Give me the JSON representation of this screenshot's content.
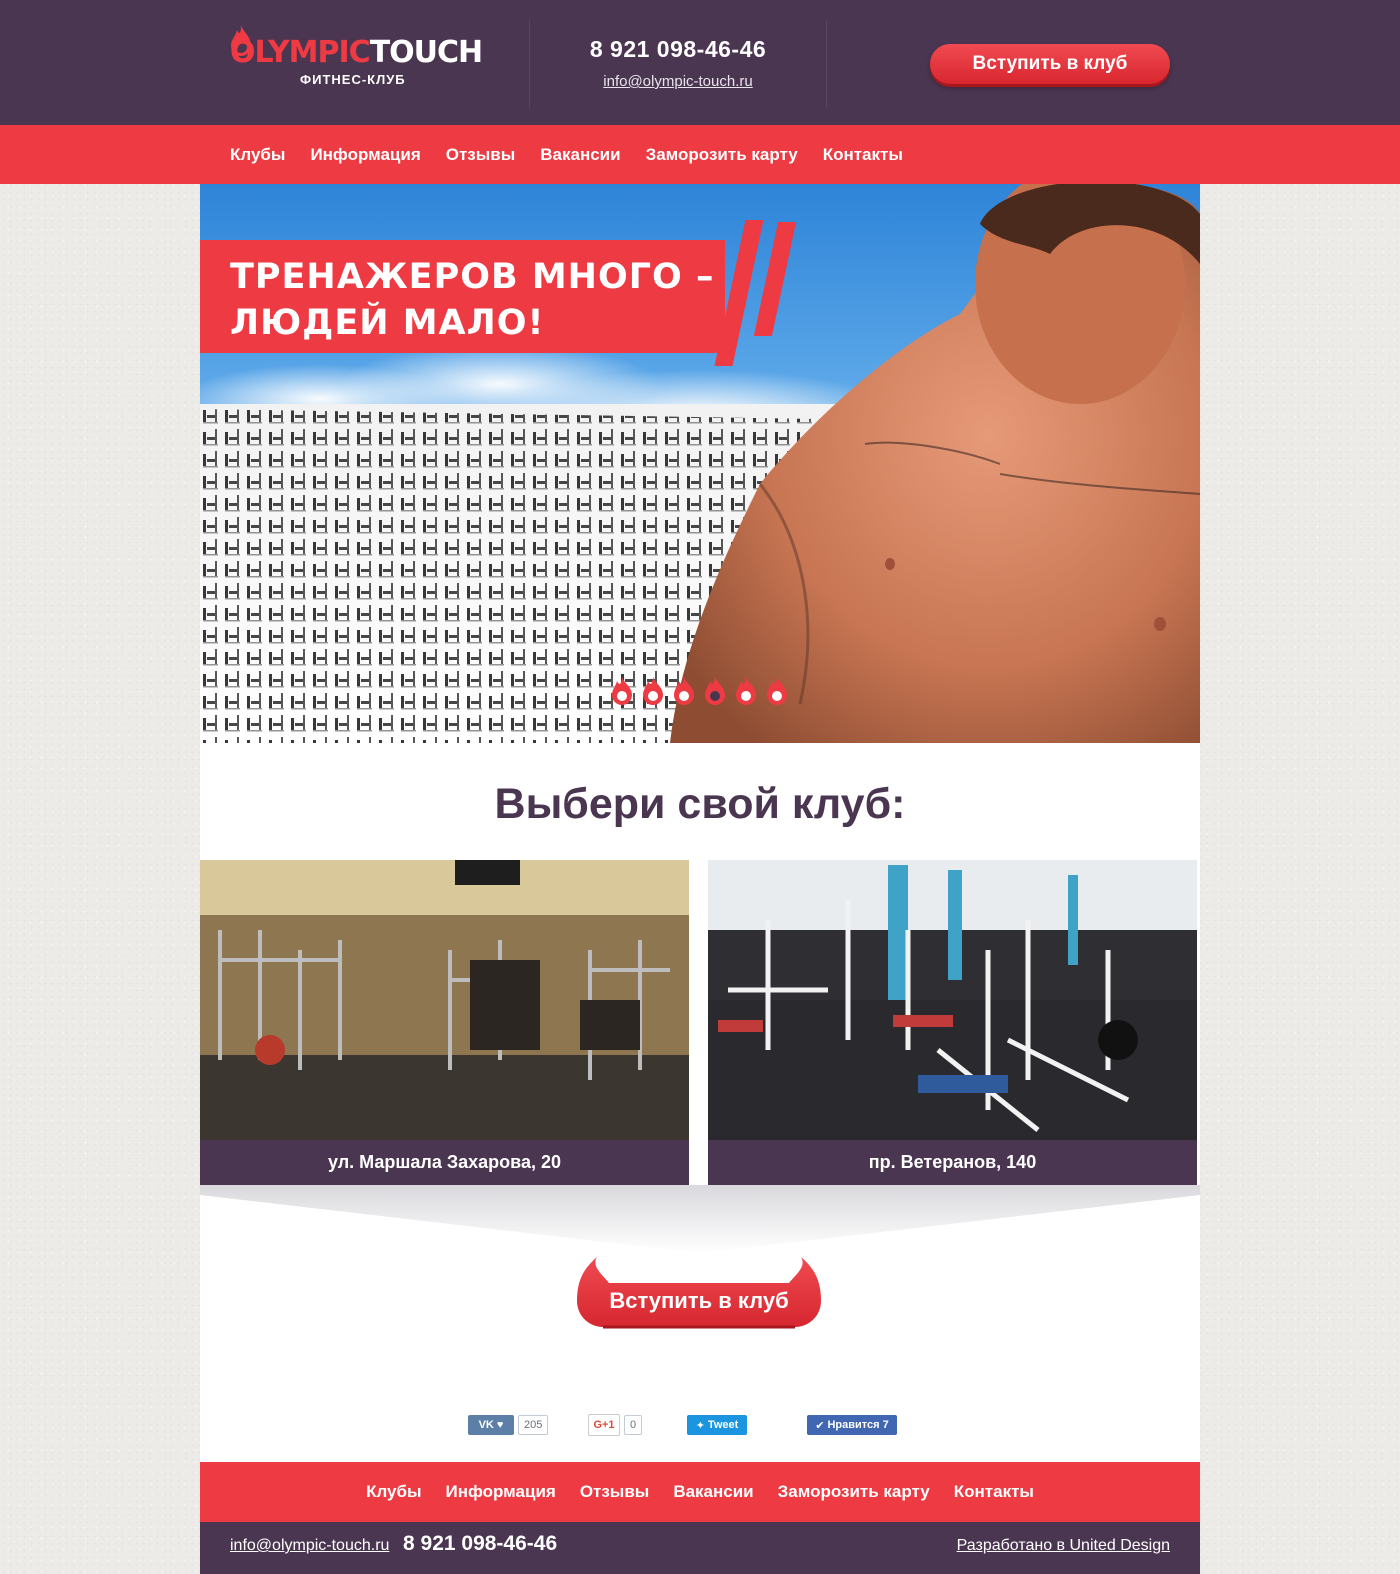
{
  "header": {
    "logo_part1": "OLYMPIC",
    "logo_part2": "TOUCH",
    "logo_subtitle": "ФИТНЕС-КЛУБ",
    "phone": "8 921 098-46-46",
    "email": "info@olympic-touch.ru",
    "join_button": "Вступить в клуб"
  },
  "nav": {
    "items": [
      "Клубы",
      "Информация",
      "Отзывы",
      "Вакансии",
      "Заморозить карту",
      "Контакты"
    ]
  },
  "hero": {
    "slogan_line1": "ТРЕНАЖЕРОВ МНОГО –",
    "slogan_line2": "ЛЮДЕЙ МАЛО!",
    "slides_count": 6,
    "active_slide": 4
  },
  "clubs": {
    "title": "Выбери свой клуб:",
    "items": [
      {
        "address": "ул. Маршала Захарова, 20"
      },
      {
        "address": "пр. Ветеранов, 140"
      }
    ],
    "join_button": "Вступить в клуб"
  },
  "social": {
    "vk_count": "205",
    "gplus_label": "G+1",
    "gplus_count": "0",
    "tweet_label": "Tweet",
    "fb_label": "Нравится 7"
  },
  "footer": {
    "nav_items": [
      "Клубы",
      "Информация",
      "Отзывы",
      "Вакансии",
      "Заморозить карту",
      "Контакты"
    ],
    "email": "info@olympic-touch.ru",
    "phone": "8 921 098-46-46",
    "developer": "Разработано в United Design"
  },
  "colors": {
    "purple": "#4b3651",
    "red": "#ee3a43",
    "white": "#ffffff"
  }
}
